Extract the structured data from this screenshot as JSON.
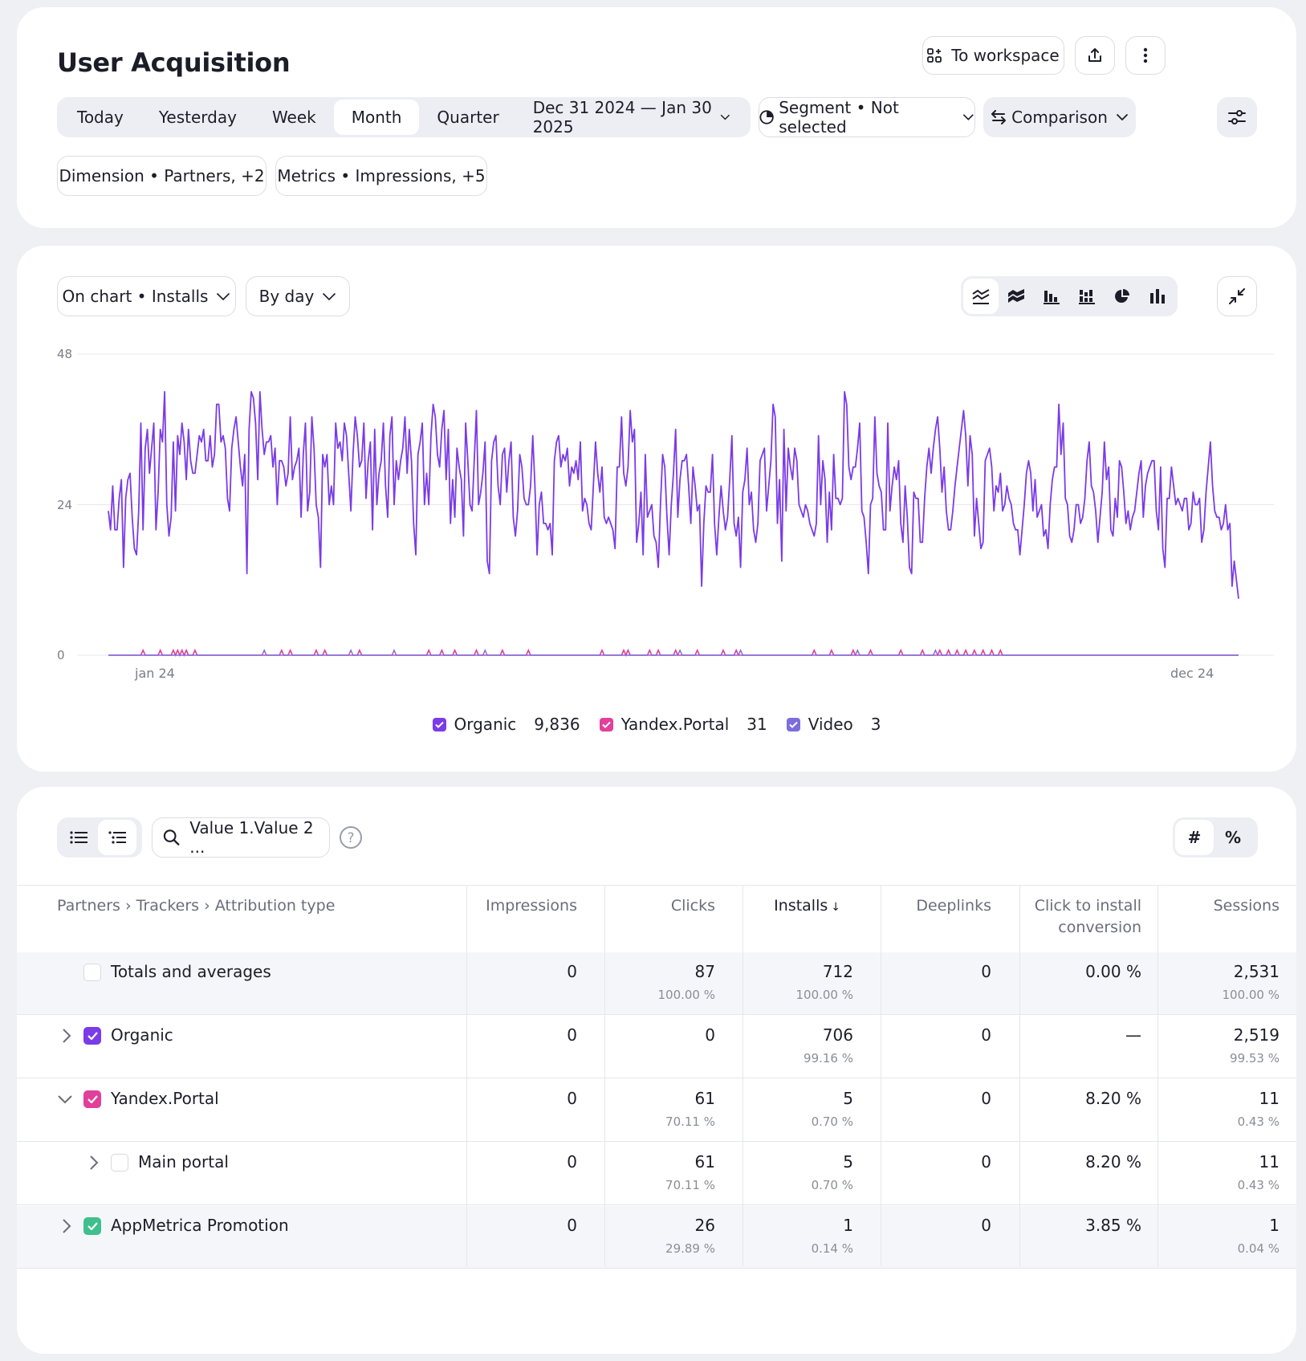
{
  "header": {
    "title": "User Acquisition",
    "to_workspace": "To workspace",
    "periods": [
      "Today",
      "Yesterday",
      "Week",
      "Month",
      "Quarter"
    ],
    "active_period": "Month",
    "date_range": "Dec 31 2024 — Jan 30 2025",
    "segment": "Segment • Not selected",
    "comparison": "Comparison",
    "dimension": "Dimension • Partners, +2",
    "metrics": "Metrics • Impressions, +5"
  },
  "chart_controls": {
    "on_chart": "On chart • Installs",
    "granularity": "By day",
    "chart_types": [
      "stacked-line-icon",
      "stacked-area-icon",
      "bar-icon",
      "stacked-bar-icon",
      "pie-icon",
      "column-icon"
    ],
    "active_chart_type": "stacked-line-icon"
  },
  "chart_data": {
    "type": "line",
    "y_ticks": [
      "48",
      "24",
      "0"
    ],
    "ylim": [
      0,
      48
    ],
    "x_ticks": [
      "jan 24",
      "dec 24"
    ],
    "grid": true,
    "legend_position": "bottom-center",
    "series": [
      {
        "name": "Organic",
        "total": "9,836",
        "color": "#7a3be8",
        "values": [
          23,
          20,
          27,
          20,
          20,
          25,
          28,
          14,
          25,
          28,
          29,
          22,
          17,
          16,
          23,
          37,
          20,
          33,
          36,
          29,
          33,
          37,
          20,
          26,
          36,
          34,
          42,
          24,
          19,
          22,
          34,
          23,
          35,
          32,
          37,
          34,
          28,
          36,
          31,
          29,
          29,
          32,
          35,
          34,
          36,
          31,
          31,
          35,
          30,
          32,
          40,
          40,
          34,
          35,
          33,
          25,
          23,
          33,
          36,
          38,
          34,
          30,
          27,
          32,
          13,
          36,
          42,
          41,
          37,
          28,
          42,
          36,
          32,
          34,
          34,
          35,
          30,
          33,
          24,
          31,
          31,
          30,
          27,
          29,
          38,
          28,
          30,
          31,
          33,
          22,
          32,
          37,
          23,
          26,
          38,
          33,
          24,
          22,
          14,
          32,
          30,
          32,
          24,
          27,
          24,
          37,
          33,
          34,
          31,
          37,
          35,
          29,
          23,
          32,
          38,
          35,
          30,
          31,
          37,
          25,
          31,
          34,
          20,
          36,
          24,
          29,
          31,
          37,
          27,
          22,
          35,
          38,
          24,
          31,
          28,
          31,
          33,
          38,
          29,
          36,
          31,
          21,
          16,
          32,
          34,
          37,
          24,
          29,
          24,
          35,
          40,
          38,
          32,
          30,
          36,
          39,
          28,
          36,
          21,
          28,
          22,
          33,
          30,
          28,
          19,
          37,
          31,
          24,
          23,
          31,
          39,
          24,
          26,
          29,
          34,
          15,
          13,
          31,
          34,
          35,
          27,
          24,
          32,
          33,
          26,
          31,
          34,
          22,
          19,
          23,
          32,
          30,
          25,
          24,
          24,
          27,
          35,
          27,
          16,
          24,
          26,
          21,
          21,
          20,
          21,
          16,
          31,
          34,
          35,
          30,
          32,
          31,
          33,
          27,
          30,
          29,
          31,
          28,
          34,
          23,
          25,
          24,
          21,
          20,
          27,
          34,
          29,
          26,
          30,
          22,
          21,
          22,
          21,
          20,
          17,
          30,
          30,
          38,
          29,
          27,
          30,
          39,
          34,
          36,
          18,
          21,
          26,
          16,
          32,
          22,
          23,
          24,
          19,
          18,
          14,
          24,
          32,
          30,
          22,
          16,
          24,
          29,
          36,
          22,
          28,
          31,
          31,
          32,
          27,
          21,
          30,
          27,
          23,
          24,
          11,
          21,
          27,
          26,
          26,
          32,
          21,
          16,
          22,
          27,
          23,
          20,
          22,
          28,
          35,
          21,
          19,
          22,
          14,
          26,
          28,
          33,
          24,
          26,
          20,
          18,
          21,
          31,
          32,
          33,
          23,
          27,
          31,
          40,
          38,
          21,
          28,
          15,
          36,
          23,
          33,
          30,
          28,
          33,
          31,
          24,
          23,
          22,
          24,
          23,
          21,
          20,
          19,
          21,
          35,
          24,
          31,
          28,
          18,
          26,
          20,
          32,
          25,
          25,
          24,
          25,
          42,
          40,
          30,
          28,
          30,
          30,
          33,
          37,
          23,
          22,
          18,
          13,
          24,
          25,
          38,
          29,
          27,
          26,
          20,
          20,
          37,
          23,
          27,
          30,
          28,
          31,
          21,
          18,
          27,
          22,
          14,
          13,
          26,
          25,
          25,
          18,
          18,
          25,
          30,
          33,
          29,
          33,
          36,
          38,
          33,
          26,
          30,
          23,
          20,
          20,
          23,
          27,
          30,
          33,
          36,
          39,
          35,
          27,
          35,
          32,
          19,
          25,
          21,
          17,
          18,
          31,
          32,
          33,
          30,
          23,
          27,
          26,
          29,
          23,
          24,
          27,
          25,
          24,
          21,
          20,
          20,
          16,
          20,
          24,
          29,
          31,
          29,
          23,
          28,
          22,
          23,
          24,
          19,
          20,
          17,
          24,
          28,
          30,
          30,
          40,
          32,
          37,
          25,
          24,
          19,
          18,
          20,
          24,
          24,
          21,
          22,
          25,
          31,
          34,
          27,
          26,
          23,
          18,
          22,
          26,
          34,
          28,
          30,
          20,
          19,
          25,
          22,
          31,
          30,
          26,
          21,
          23,
          20,
          22,
          23,
          26,
          29,
          31,
          22,
          27,
          29,
          30,
          31,
          31,
          23,
          20,
          30,
          17,
          14,
          25,
          25,
          30,
          27,
          24,
          25,
          24,
          23,
          25,
          25,
          20,
          21,
          26,
          24,
          24,
          25,
          18,
          20,
          26,
          30,
          34,
          27,
          23,
          22,
          22,
          20,
          21,
          24,
          20,
          21,
          11,
          15,
          12,
          9
        ]
      },
      {
        "name": "Yandex.Portal",
        "total": "31",
        "color": "#e0409a"
      },
      {
        "name": "Video",
        "total": "3",
        "color": "#7c6cdc"
      }
    ]
  },
  "table": {
    "search_placeholder": "Value 1.Value 2 ...",
    "hash_label": "#",
    "percent_label": "%",
    "dimension_header": "Partners › Trackers › Attribution type",
    "columns": [
      "Impressions",
      "Clicks",
      "Installs",
      "Deeplinks",
      "Click to install conversion",
      "Sessions"
    ],
    "sort_indicator": "↓",
    "rows": [
      {
        "label": "Totals and averages",
        "values": [
          "0",
          "87",
          "712",
          "0",
          "0.00 %",
          "2,531"
        ],
        "subs": [
          "",
          "100.00 %",
          "100.00 %",
          "",
          "",
          "100.00 %"
        ]
      },
      {
        "label": "Organic",
        "values": [
          "0",
          "0",
          "706",
          "0",
          "—",
          "2,519"
        ],
        "subs": [
          "",
          "",
          "99.16 %",
          "",
          "",
          "99.53 %"
        ]
      },
      {
        "label": "Yandex.Portal",
        "values": [
          "0",
          "61",
          "5",
          "0",
          "8.20 %",
          "11"
        ],
        "subs": [
          "",
          "70.11 %",
          "0.70 %",
          "",
          "",
          "0.43 %"
        ]
      },
      {
        "label": "Main portal",
        "values": [
          "0",
          "61",
          "5",
          "0",
          "8.20 %",
          "11"
        ],
        "subs": [
          "",
          "70.11 %",
          "0.70 %",
          "",
          "",
          "0.43 %"
        ]
      },
      {
        "label": "AppMetrica Promotion",
        "values": [
          "0",
          "26",
          "1",
          "0",
          "3.85 %",
          "1"
        ],
        "subs": [
          "",
          "29.89 %",
          "0.14 %",
          "",
          "",
          "0.04 %"
        ]
      }
    ]
  },
  "colors": {
    "organic": "#7a3be8",
    "yandex_portal": "#e0409a",
    "video": "#7c6cdc",
    "appmetrica": "#3fbf8e"
  }
}
